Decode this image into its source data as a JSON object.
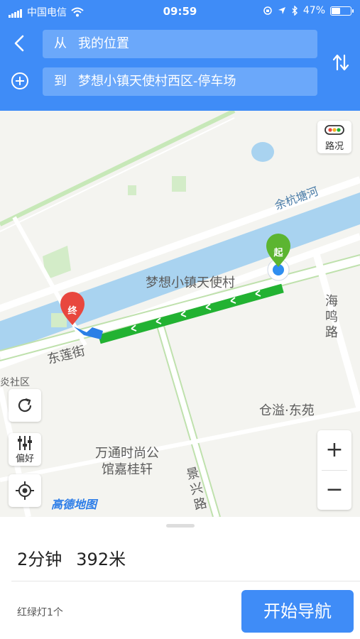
{
  "status_bar": {
    "carrier": "中国电信",
    "time": "09:59",
    "battery": "47%",
    "battery_level": 0.47
  },
  "route_inputs": {
    "from_prefix": "从",
    "from_value": "我的位置",
    "to_prefix": "到",
    "to_value": "梦想小镇天使村西区-停车场"
  },
  "map": {
    "traffic_label": "路况",
    "preference_label": "偏好",
    "logo": "高德地图",
    "start_marker": "起",
    "end_marker": "终",
    "labels": {
      "river": "余杭塘河",
      "village": "梦想小镇天使村",
      "haiming_road": "海鸣路",
      "donglian_street": "东莲街",
      "community": "炎社区",
      "cangyi": "仓溢·东苑",
      "wantong_1": "万通时尚公",
      "wantong_2": "馆嘉桂轩",
      "jingxing_road": "景兴路"
    },
    "colors": {
      "route": "#22b232",
      "start_pin": "#5cb531",
      "end_pin": "#e8473e",
      "accent": "#3f8cf7"
    }
  },
  "route_summary": {
    "duration": "2分钟",
    "distance": "392米",
    "traffic_lights": "红绿灯1个",
    "start_button": "开始导航"
  }
}
